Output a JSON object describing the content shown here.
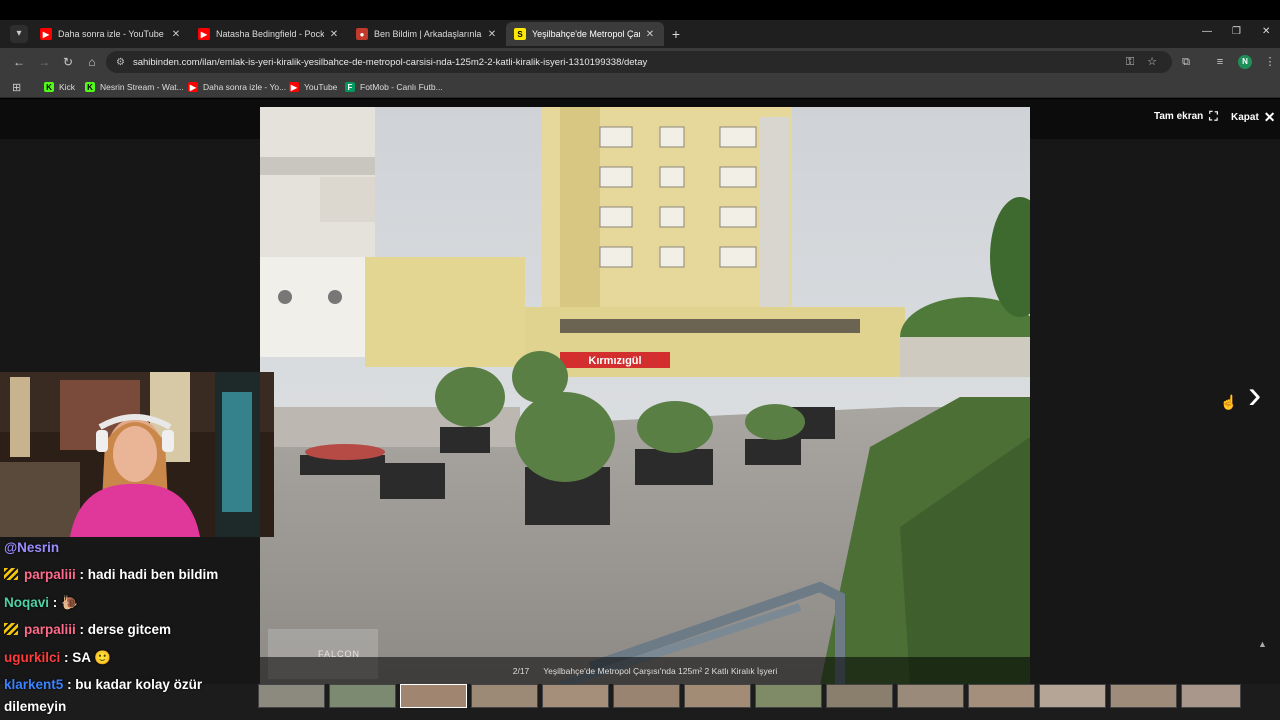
{
  "browser": {
    "tabs": [
      {
        "title": "Daha sonra izle - YouTube",
        "favicon": "youtube-icon",
        "color": "#ff0000",
        "active": false
      },
      {
        "title": "Natasha Bedingfield - Pocketful",
        "favicon": "youtube-icon",
        "color": "#ff0000",
        "active": false
      },
      {
        "title": "Ben Bildim | Arkadaşlarınla Onli",
        "favicon": "game-icon",
        "color": "#c0392b",
        "active": false
      },
      {
        "title": "Yeşilbahçe'de Metropol Çarşısı'",
        "favicon": "sahibinden-icon",
        "color": "#ffe800",
        "active": true
      }
    ],
    "new_tab": "+",
    "url": "sahibinden.com/ilan/emlak-is-yeri-kiralik-yesilbahce-de-metropol-carsisi-nda-125m2-2-katli-kiralik-isyeri-1310199338/detay",
    "profile_initial": "N",
    "bookmarks": [
      {
        "label": "Kick",
        "icon": "kick-icon",
        "color": "#53fc18"
      },
      {
        "label": "Nesrin Stream - Wat...",
        "icon": "kick-icon",
        "color": "#53fc18"
      },
      {
        "label": "Daha sonra izle - Yo...",
        "icon": "youtube-icon",
        "color": "#ff0000"
      },
      {
        "label": "YouTube",
        "icon": "youtube-icon",
        "color": "#ff0000"
      },
      {
        "label": "FotMob - Canlı Futb...",
        "icon": "fotmob-icon",
        "color": "#00985f"
      }
    ]
  },
  "gallery": {
    "fullscreen_label": "Tam ekran",
    "close_label": "Kapat",
    "counter": "2/17",
    "caption": "Yeşilbahçe'de Metropol Çarşısı'nda 125m² 2 Katlı Kiralık İşyeri",
    "photo_shop_sign": "Kırmızıgül",
    "watermark": "FALCON",
    "thumbnail_count": 14
  },
  "chat": {
    "messages": [
      {
        "user": "@Nesrin",
        "text": "",
        "user_color": "#9b8cff",
        "badge": false
      },
      {
        "user": "parpaliii",
        "text": ": hadi hadi ben bildim",
        "user_color": "#ff6b8b",
        "badge": true
      },
      {
        "user": "Noqavi",
        "text": ": 🐌",
        "user_color": "#4fd1a5",
        "badge": false
      },
      {
        "user": "parpaliii",
        "text": ": derse gitcem",
        "user_color": "#ff6b8b",
        "badge": true
      },
      {
        "user": "ugurkilci",
        "text": ": SA 🙂",
        "user_color": "#ff3b3b",
        "badge": false
      },
      {
        "user": "klarkent5",
        "text": ": bu kadar kolay özür",
        "user_color": "#3b82ff",
        "badge": false
      },
      {
        "user": "",
        "text": "dilemeyin",
        "user_color": "#ffffff",
        "badge": false
      }
    ]
  }
}
